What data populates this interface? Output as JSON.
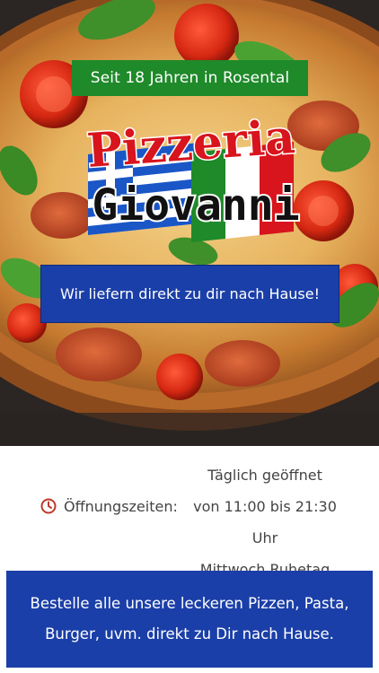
{
  "hero": {
    "badge_since": "Seit 18 Jahren in Rosental",
    "logo_word_1": "Pizzeria",
    "logo_word_2": "Giovanni",
    "delivery_banner": "Wir liefern direkt zu dir nach Hause!"
  },
  "hours": {
    "label": "Öffnungszeiten:",
    "line_1": "Täglich geöffnet",
    "line_2": "von 11:00 bis 21:30 Uhr",
    "line_3": "Mittwoch Ruhetag",
    "icon": "clock-icon"
  },
  "order": {
    "line_1": "Bestelle alle unsere leckeren Pizzen, Pasta,",
    "line_2": "Burger, uvm. direkt zu Dir nach Hause."
  },
  "colors": {
    "badge_green": "#1f8a2a",
    "banner_blue": "#1b3fa8",
    "logo_red": "#d8141c",
    "icon_red": "#c0392b",
    "text_gray": "#444444"
  }
}
